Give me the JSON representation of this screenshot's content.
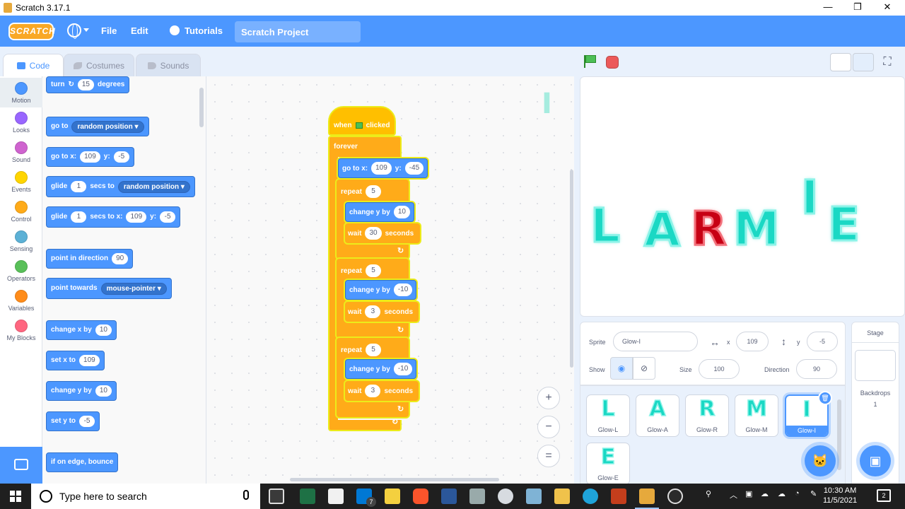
{
  "window": {
    "title": "Scratch 3.17.1",
    "minimize": "—",
    "restore": "❐",
    "close": "✕"
  },
  "menubar": {
    "logo": "SCRATCH",
    "file": "File",
    "edit": "Edit",
    "tutorials": "Tutorials",
    "project_name": "Scratch Project"
  },
  "tabs": [
    {
      "label": "Code",
      "icon": "code-icon"
    },
    {
      "label": "Costumes",
      "icon": "brush-icon"
    },
    {
      "label": "Sounds",
      "icon": "speaker-icon"
    }
  ],
  "categories": [
    {
      "label": "Motion",
      "color": "#4c97ff"
    },
    {
      "label": "Looks",
      "color": "#9966ff"
    },
    {
      "label": "Sound",
      "color": "#cf63cf"
    },
    {
      "label": "Events",
      "color": "#ffd500"
    },
    {
      "label": "Control",
      "color": "#ffab19"
    },
    {
      "label": "Sensing",
      "color": "#5cb1d6"
    },
    {
      "label": "Operators",
      "color": "#59c059"
    },
    {
      "label": "Variables",
      "color": "#ff8c1a"
    },
    {
      "label": "My Blocks",
      "color": "#ff6680"
    }
  ],
  "palette": {
    "turn": {
      "text": "turn",
      "value": "15",
      "suffix": "degrees"
    },
    "goto": {
      "text": "go to",
      "option": "random position"
    },
    "gotoxy": {
      "text": "go to x:",
      "x": "109",
      "ylabel": "y:",
      "y": "-5"
    },
    "glide1": {
      "text": "glide",
      "secs": "1",
      "mid": "secs to",
      "option": "random position"
    },
    "glide2": {
      "text": "glide",
      "secs": "1",
      "mid": "secs to x:",
      "x": "109",
      "ylabel": "y:",
      "y": "-5"
    },
    "point_dir": {
      "text": "point in direction",
      "value": "90"
    },
    "point_towards": {
      "text": "point towards",
      "option": "mouse-pointer"
    },
    "change_x": {
      "text": "change x by",
      "value": "10"
    },
    "set_x": {
      "text": "set x to",
      "value": "109"
    },
    "change_y": {
      "text": "change y by",
      "value": "10"
    },
    "set_y": {
      "text": "set y to",
      "value": "-5"
    },
    "bounce": {
      "text": "if on edge, bounce"
    }
  },
  "script": {
    "hat": {
      "when": "when",
      "clicked": "clicked"
    },
    "forever": "forever",
    "gotoxy": {
      "text": "go to x:",
      "x": "109",
      "ylabel": "y:",
      "y": "-45"
    },
    "repeats": [
      {
        "label": "repeat",
        "times": "5",
        "change_label": "change y by",
        "change": "10",
        "wait_label": "wait",
        "wait": "30",
        "seconds": "seconds"
      },
      {
        "label": "repeat",
        "times": "5",
        "change_label": "change y by",
        "change": "-10",
        "wait_label": "wait",
        "wait": "3",
        "seconds": "seconds"
      },
      {
        "label": "repeat",
        "times": "5",
        "change_label": "change y by",
        "change": "-10",
        "wait_label": "wait",
        "wait": "3",
        "seconds": "seconds"
      }
    ],
    "loop_arrow": "↻"
  },
  "zoom": {
    "in": "+",
    "out": "−",
    "reset": "="
  },
  "workspace_sprite_glyph": "I",
  "stage_letters": [
    {
      "char": "L",
      "color": "#1ad8c4"
    },
    {
      "char": "A",
      "color": "#1ad8c4"
    },
    {
      "char": "R",
      "color": "#c70014"
    },
    {
      "char": "M",
      "color": "#1ad8c4"
    },
    {
      "char": "I",
      "color": "#1ad8c4"
    },
    {
      "char": "E",
      "color": "#1ad8c4"
    }
  ],
  "sprite_info": {
    "sprite_label": "Sprite",
    "sprite_name": "Glow-I",
    "x_label": "x",
    "x": "109",
    "y_label": "y",
    "y": "-5",
    "show_label": "Show",
    "size_label": "Size",
    "size": "100",
    "direction_label": "Direction",
    "direction": "90"
  },
  "sprites": [
    {
      "glyph": "L",
      "name": "Glow-L",
      "selected": false
    },
    {
      "glyph": "A",
      "name": "Glow-A",
      "selected": false
    },
    {
      "glyph": "R",
      "name": "Glow-R",
      "selected": false
    },
    {
      "glyph": "M",
      "name": "Glow-M",
      "selected": false
    },
    {
      "glyph": "I",
      "name": "Glow-I",
      "selected": true
    },
    {
      "glyph": "E",
      "name": "Glow-E",
      "selected": false
    }
  ],
  "stage_panel": {
    "title": "Stage",
    "backdrops_label": "Backdrops",
    "backdrops_count": "1"
  },
  "taskbar": {
    "search_placeholder": "Type here to search",
    "mail_badge": "7",
    "time": "10:30 AM",
    "date": "11/5/2021",
    "notifications": "2"
  }
}
